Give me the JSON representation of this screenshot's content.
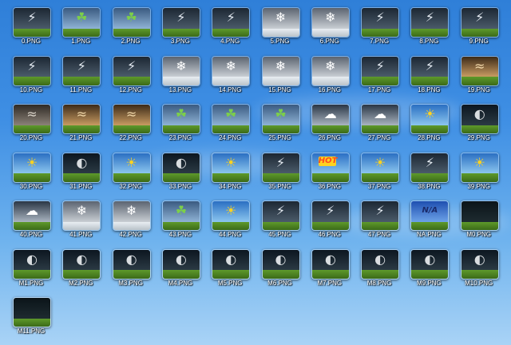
{
  "desktop": {
    "icons": [
      {
        "label": "0.PNG",
        "scene": "storm"
      },
      {
        "label": "1.PNG",
        "scene": "leaves"
      },
      {
        "label": "2.PNG",
        "scene": "leaves"
      },
      {
        "label": "3.PNG",
        "scene": "storm"
      },
      {
        "label": "4.PNG",
        "scene": "storm"
      },
      {
        "label": "5.PNG",
        "scene": "snow"
      },
      {
        "label": "6.PNG",
        "scene": "snow"
      },
      {
        "label": "7.PNG",
        "scene": "storm"
      },
      {
        "label": "8.PNG",
        "scene": "storm"
      },
      {
        "label": "9.PNG",
        "scene": "storm"
      },
      {
        "label": "10.PNG",
        "scene": "storm"
      },
      {
        "label": "11.PNG",
        "scene": "storm"
      },
      {
        "label": "12.PNG",
        "scene": "storm"
      },
      {
        "label": "13.PNG",
        "scene": "snow"
      },
      {
        "label": "14.PNG",
        "scene": "snow"
      },
      {
        "label": "15.PNG",
        "scene": "snow"
      },
      {
        "label": "16.PNG",
        "scene": "snow"
      },
      {
        "label": "17.PNG",
        "scene": "storm"
      },
      {
        "label": "18.PNG",
        "scene": "storm"
      },
      {
        "label": "19.PNG",
        "scene": "dust"
      },
      {
        "label": "20.PNG",
        "scene": "fog"
      },
      {
        "label": "21.PNG",
        "scene": "dust"
      },
      {
        "label": "22.PNG",
        "scene": "dust"
      },
      {
        "label": "23.PNG",
        "scene": "leaves"
      },
      {
        "label": "24.PNG",
        "scene": "leaves"
      },
      {
        "label": "25.PNG",
        "scene": "leaves"
      },
      {
        "label": "26.PNG",
        "scene": "cloudy"
      },
      {
        "label": "27.PNG",
        "scene": "cloudy"
      },
      {
        "label": "28.PNG",
        "scene": "sunny"
      },
      {
        "label": "29.PNG",
        "scene": "moon"
      },
      {
        "label": "30.PNG",
        "scene": "sunny"
      },
      {
        "label": "31.PNG",
        "scene": "moon"
      },
      {
        "label": "32.PNG",
        "scene": "sunny"
      },
      {
        "label": "33.PNG",
        "scene": "moon"
      },
      {
        "label": "34.PNG",
        "scene": "sunny"
      },
      {
        "label": "35.PNG",
        "scene": "storm"
      },
      {
        "label": "36.PNG",
        "scene": "hot",
        "badge": "HOT"
      },
      {
        "label": "37.PNG",
        "scene": "sunny"
      },
      {
        "label": "38.PNG",
        "scene": "storm"
      },
      {
        "label": "39.PNG",
        "scene": "sunny"
      },
      {
        "label": "40.PNG",
        "scene": "cloudy"
      },
      {
        "label": "41.PNG",
        "scene": "snow"
      },
      {
        "label": "42.PNG",
        "scene": "snow"
      },
      {
        "label": "43.PNG",
        "scene": "leaves"
      },
      {
        "label": "44.PNG",
        "scene": "sunny"
      },
      {
        "label": "45.PNG",
        "scene": "storm"
      },
      {
        "label": "46.PNG",
        "scene": "storm"
      },
      {
        "label": "47.PNG",
        "scene": "storm"
      },
      {
        "label": "NA.PNG",
        "scene": "na",
        "badge": "N/A"
      },
      {
        "label": "M0.PNG",
        "scene": "night"
      },
      {
        "label": "M1.PNG",
        "scene": "moon"
      },
      {
        "label": "M2.PNG",
        "scene": "moon"
      },
      {
        "label": "M3.PNG",
        "scene": "moon"
      },
      {
        "label": "M4.PNG",
        "scene": "moon"
      },
      {
        "label": "M5.PNG",
        "scene": "moon"
      },
      {
        "label": "M6.PNG",
        "scene": "moon"
      },
      {
        "label": "M7.PNG",
        "scene": "moon"
      },
      {
        "label": "M8.PNG",
        "scene": "moon"
      },
      {
        "label": "M9.PNG",
        "scene": "moon"
      },
      {
        "label": "M10.PNG",
        "scene": "moon"
      },
      {
        "label": "M11.PNG",
        "scene": "night"
      }
    ]
  }
}
